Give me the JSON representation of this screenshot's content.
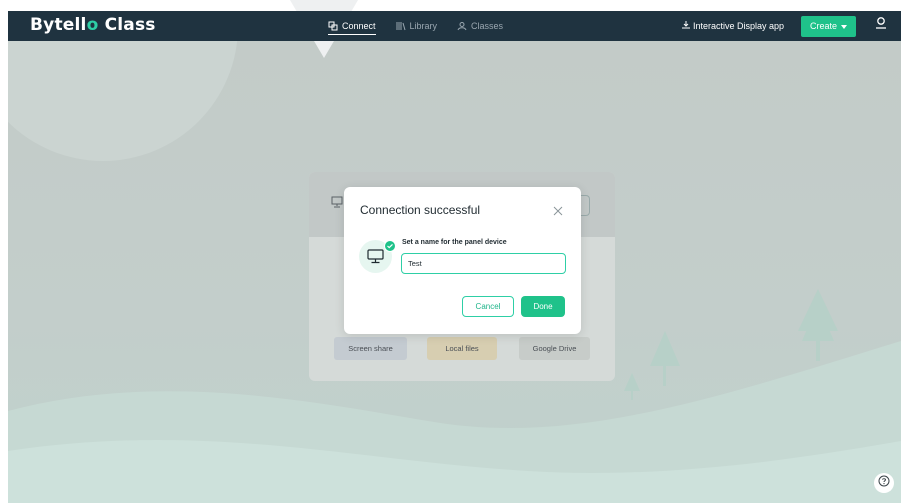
{
  "app": {
    "logo_prefix": "Bytell",
    "logo_o": "o",
    "logo_suffix": " Class"
  },
  "nav": {
    "connect": "Connect",
    "library": "Library",
    "classes": "Classes"
  },
  "header_right": {
    "display_app": "Interactive Display app",
    "create": "Create"
  },
  "card": {
    "tiles": [
      "Screen share",
      "Local files",
      "Google Drive"
    ]
  },
  "modal": {
    "title": "Connection successful",
    "field_label": "Set a name for the panel device",
    "input_value": "Test",
    "cancel": "Cancel",
    "done": "Done"
  },
  "colors": {
    "header_bg": "#1f3340",
    "accent": "#1fc28a",
    "accent_light": "#2ecfa6"
  },
  "icons": [
    "connect-icon",
    "library-icon",
    "classes-icon",
    "download-icon",
    "caret-down-icon",
    "user-icon",
    "monitor-icon",
    "check-badge-icon",
    "close-icon",
    "help-icon",
    "tree-icon"
  ]
}
